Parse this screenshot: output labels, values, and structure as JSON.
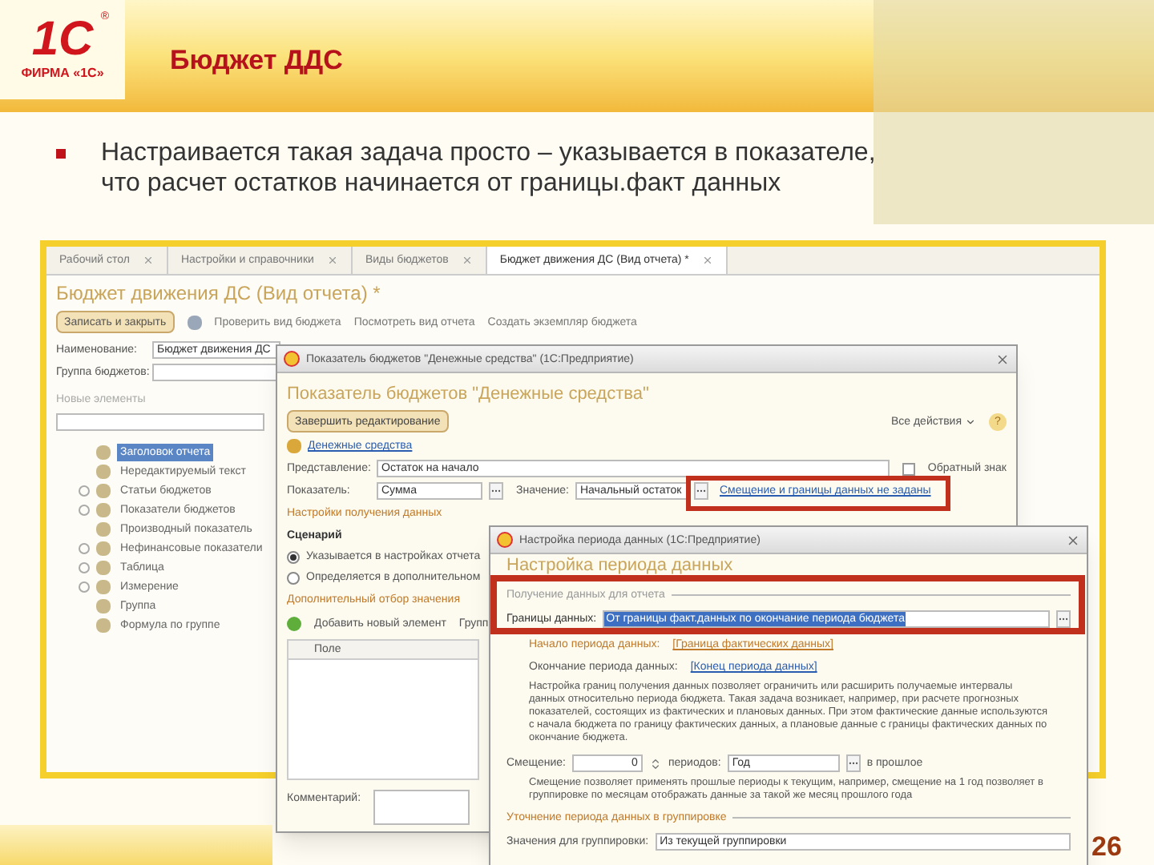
{
  "slide": {
    "logo_mark": "1С",
    "logo_registered": "®",
    "logo_text": "ФИРМА «1С»",
    "title": "Бюджет ДДС",
    "bullet": "Настраивается такая задача просто – указывается в показателе, что расчет остатков начинается от границы.факт данных",
    "page_number": "26"
  },
  "main_window": {
    "tabs": [
      {
        "label": "Рабочий стол",
        "selected": false
      },
      {
        "label": "Настройки и справочники",
        "selected": false
      },
      {
        "label": "Виды бюджетов",
        "selected": false
      },
      {
        "label": "Бюджет движения ДС (Вид отчета) *",
        "selected": true
      }
    ],
    "title": "Бюджет движения ДС (Вид отчета) *",
    "save_button": "Записать и закрыть",
    "toolbar": [
      "Проверить вид бюджета",
      "Посмотреть вид отчета",
      "Создать экземпляр бюджета"
    ],
    "name_label": "Наименование:",
    "name_value": "Бюджет движения ДС",
    "group_label": "Группа бюджетов:",
    "new_elements": "Новые элементы",
    "tree": [
      {
        "label": "Заголовок отчета",
        "selected": true,
        "toggle": false
      },
      {
        "label": "Нередактируемый текст",
        "selected": false,
        "toggle": false
      },
      {
        "label": "Статьи бюджетов",
        "selected": false,
        "toggle": true
      },
      {
        "label": "Показатели бюджетов",
        "selected": false,
        "toggle": true
      },
      {
        "label": "Производный показатель",
        "selected": false,
        "toggle": false
      },
      {
        "label": "Нефинансовые показатели",
        "selected": false,
        "toggle": true
      },
      {
        "label": "Таблица",
        "selected": false,
        "toggle": true
      },
      {
        "label": "Измерение",
        "selected": false,
        "toggle": true
      },
      {
        "label": "Группа",
        "selected": false,
        "toggle": false
      },
      {
        "label": "Формула по группе",
        "selected": false,
        "toggle": false
      }
    ]
  },
  "indicator_dialog": {
    "window_title": "Показатель бюджетов \"Денежные средства\" (1С:Предприятие)",
    "heading": "Показатель бюджетов \"Денежные средства\"",
    "finish_button": "Завершить редактирование",
    "all_actions": "Все действия",
    "help": "?",
    "link": "Денежные средства",
    "presentation_label": "Представление:",
    "presentation_value": "Остаток на начало",
    "reverse_sign": {
      "label": "Обратный знак",
      "checked": false
    },
    "indicator_label": "Показатель:",
    "indicator_value": "Сумма",
    "value_label": "Значение:",
    "value_value": "Начальный остаток",
    "offset_link": "Смещение и границы данных не заданы",
    "data_settings": "Настройки получения данных",
    "scenario": "Сценарий",
    "scenario_options": [
      {
        "label": "Указывается в настройках отчета",
        "selected": true
      },
      {
        "label": "Определяется в дополнительном",
        "selected": false
      }
    ],
    "filter_title": "Дополнительный отбор значения",
    "add_button": "Добавить новый элемент",
    "group_button": "Групп",
    "column": "Поле",
    "comment_label": "Комментарий:"
  },
  "period_dialog": {
    "window_title": "Настройка периода данных (1С:Предприятие)",
    "heading": "Настройка периода данных",
    "group_title": "Получение данных для отчета",
    "bounds_label": "Границы данных:",
    "bounds_value": "От границы факт.данных по окончание периода бюджета",
    "start_label": "Начало периода данных:",
    "start_link": "[Граница фактических данных]",
    "end_label": "Окончание периода данных:",
    "end_link": "[Конец периода данных]",
    "bounds_note": "Настройка границ получения данных позволяет ограничить или расширить получаемые интервалы данных относительно периода бюджета. Такая задача возникает, например, при расчете прогнозных показателей, состоящих из фактических и плановых данных. При этом фактические данные используются с начала бюджета по границу фактических данных, а плановые данные с границы фактических данных по окончание бюджета.",
    "offset_label": "Смещение:",
    "offset_value": "0",
    "periods_label": "периодов:",
    "period_value": "Год",
    "direction": "в прошлое",
    "offset_note": "Смещение позволяет применять прошлые периоды к текущим, например, смещение на 1 год позволяет в группировке по месяцам отображать данные за такой же месяц прошлого года",
    "grouping_title": "Уточнение периода данных в группировке",
    "grouping_label": "Значения для группировки:",
    "grouping_value": "Из текущей группировки"
  }
}
